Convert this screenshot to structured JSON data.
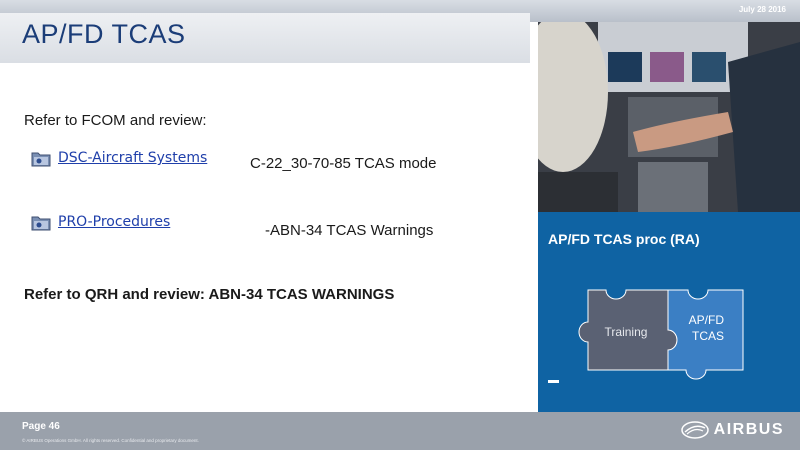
{
  "header": {
    "date": "July 28 2016",
    "title": "AP/FD TCAS"
  },
  "content": {
    "intro": "Refer to FCOM  and review:",
    "links": [
      {
        "label": "DSC-Aircraft Systems",
        "icon": "folder-link-icon"
      },
      {
        "label": "PRO-Procedures",
        "icon": "folder-link-icon"
      }
    ],
    "fcom_items": [
      "C-22_30-70-85 TCAS mode",
      "-ABN-34 TCAS Warnings"
    ],
    "qrh_note": "Refer to QRH and review: ABN-34 TCAS WARNINGS"
  },
  "side_panel": {
    "title": "AP/FD TCAS proc (RA)",
    "puzzle_pieces": [
      "Training",
      "AP/FD TCAS"
    ],
    "colors": {
      "panel": "#0f63a3",
      "piece_left": "#5a6173",
      "piece_right": "#3b7fc4"
    }
  },
  "footer": {
    "page": "Page 46",
    "copyright": "© AIRBUS Operations GmbH. All rights reserved. Confidential and proprietary document.",
    "logo_text": "AIRBUS"
  }
}
